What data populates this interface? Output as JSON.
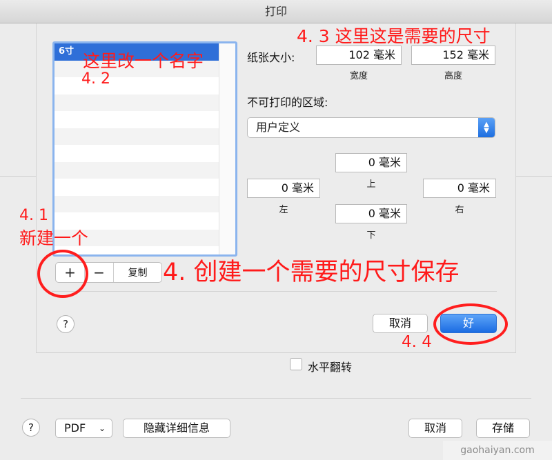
{
  "window": {
    "title": "打印"
  },
  "paper_list": {
    "selected": "6寸"
  },
  "list_buttons": {
    "add": "+",
    "remove": "−",
    "duplicate": "复制"
  },
  "paper_size": {
    "label": "纸张大小:",
    "width": "102 毫米",
    "height": "152 毫米",
    "width_caption": "宽度",
    "height_caption": "高度"
  },
  "non_printable": {
    "label": "不可打印的区域:",
    "selected": "用户定义",
    "top": "0 毫米",
    "left": "0 毫米",
    "right": "0 毫米",
    "bottom": "0 毫米",
    "top_caption": "上",
    "left_caption": "左",
    "right_caption": "右",
    "bottom_caption": "下"
  },
  "sheet_buttons": {
    "help": "?",
    "cancel": "取消",
    "ok": "好"
  },
  "flip": {
    "label": "水平翻转"
  },
  "footer": {
    "help": "?",
    "pdf": "PDF",
    "hide_details": "隐藏详细信息",
    "cancel": "取消",
    "save": "存储"
  },
  "annotations": {
    "a43": "4. 3 这里这是需要的尺寸",
    "a42_line1": "这里改一个名字",
    "a42_line2": "4. 2",
    "a41_line1": "4. 1",
    "a41_line2": "新建一个",
    "a4": "4. 创建一个需要的尺寸保存",
    "a44": "4. 4"
  },
  "watermark": "gaohaiyan.com",
  "colors": {
    "accent": "#2f6fd8",
    "annotation": "#ff1a1a",
    "selection": "#2f6fd8"
  },
  "icons": {
    "select": "chevron-up-down-icon",
    "popup": "chevron-down-icon"
  }
}
